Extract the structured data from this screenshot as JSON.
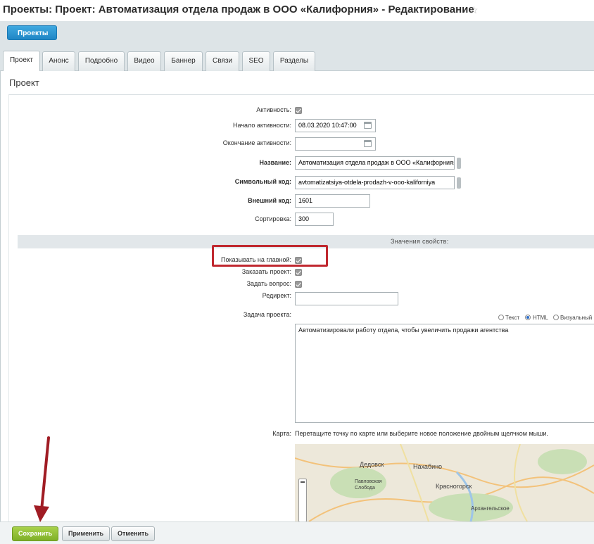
{
  "header": {
    "title": "Проекты: Проект: Автоматизация отдела продаж в ООО «Калифорния» - Редактирование",
    "chain_button": "Проекты"
  },
  "tabs": [
    {
      "label": "Проект",
      "active": true
    },
    {
      "label": "Анонс"
    },
    {
      "label": "Подробно"
    },
    {
      "label": "Видео"
    },
    {
      "label": "Баннер"
    },
    {
      "label": "Связи"
    },
    {
      "label": "SEO"
    },
    {
      "label": "Разделы"
    }
  ],
  "section_title": "Проект",
  "form": {
    "active_label": "Активность:",
    "start_label": "Начало активности:",
    "start_value": "08.03.2020 10:47:00",
    "end_label": "Окончание активности:",
    "end_value": "",
    "name_label": "Название:",
    "name_value": "Автоматизация отдела продаж в ООО «Калифорния»",
    "code_label": "Символьный код:",
    "code_value": "avtomatizatsiya-otdela-prodazh-v-ooo-kaliforniya",
    "ext_code_label": "Внешний код:",
    "ext_code_value": "1601",
    "sort_label": "Сортировка:",
    "sort_value": "300"
  },
  "props": {
    "header": "Значения свойств:",
    "show_main_label": "Показывать на главной:",
    "order_label": "Заказать проект:",
    "ask_label": "Задать вопрос:",
    "redirect_label": "Редирект:",
    "redirect_value": "",
    "task_label": "Задача проекта:",
    "editor_modes": [
      "Текст",
      "HTML",
      "Визуальный р"
    ],
    "task_value": "Автоматизировали работу отдела, чтобы увеличить продажи агентства",
    "map_label": "Карта:",
    "map_hint": "Перетащите точку по карте или выберите новое положение двойным щелчком мыши.",
    "map_places": [
      "Дедовск",
      "Нахабино",
      "Павловская Слобода",
      "Красногорск",
      "Архангельское"
    ]
  },
  "buttons": {
    "save": "Сохранить",
    "apply": "Применить",
    "cancel": "Отменить"
  },
  "colors": {
    "highlight": "#c0282f",
    "arrow": "#a01c24",
    "save_button": "#8fbe35",
    "chain_button": "#2a95d3"
  },
  "icons": [
    "star-icon",
    "calendar-icon",
    "checkbox-icon",
    "map-zoom-icon"
  ]
}
